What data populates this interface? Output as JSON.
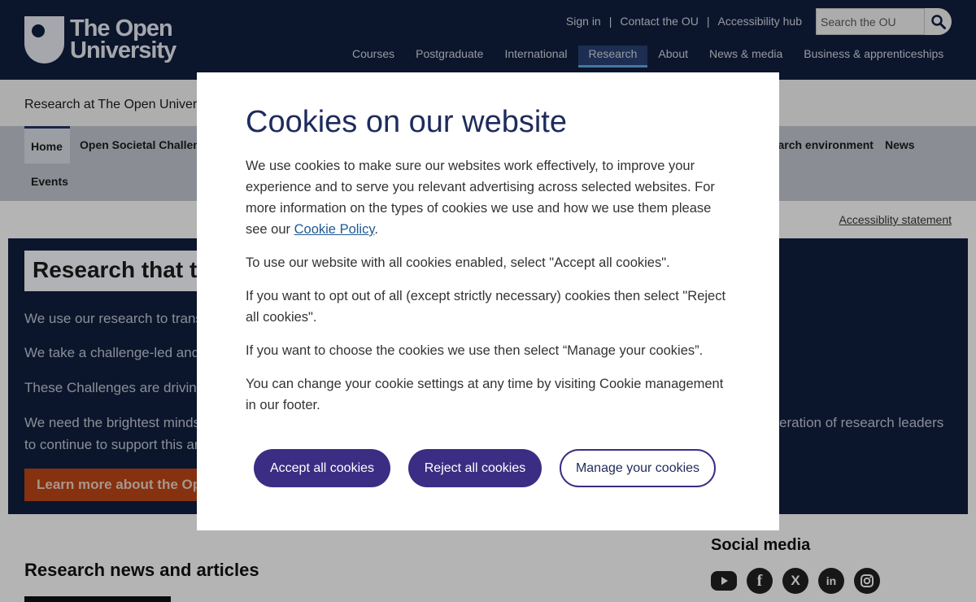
{
  "header": {
    "logo": {
      "line1": "The Open",
      "line2": "University"
    },
    "util_links": [
      "Sign in",
      "Contact the OU",
      "Accessibility hub"
    ],
    "search_placeholder": "Search the OU",
    "nav": [
      "Courses",
      "Postgraduate",
      "International",
      "Research",
      "About",
      "News & media",
      "Business & apprenticeships"
    ],
    "active_nav": "Research"
  },
  "subheader": {
    "title": "Research at The Open University",
    "nav": {
      "home": "Home",
      "open_societal": "Open Societal Challenges",
      "research_env": "Research environment",
      "news": "News",
      "events": "Events"
    }
  },
  "accessibility_statement": "Accessiblity statement",
  "hero": {
    "title": "Research that transforms lives",
    "paragraphs": [
      "We use our research to transform",
      "We take a challenge-led and",
      "These Challenges are driving",
      "We need the brightest minds",
      "to continue to support this and",
      "eration of research leaders"
    ],
    "button": "Learn more about the Open Societal Challenges"
  },
  "lower": {
    "news_heading": "Research news and articles",
    "social_heading": "Social media",
    "social_icons": [
      "youtube-icon",
      "facebook-icon",
      "x-icon",
      "linkedin-icon",
      "instagram-icon"
    ]
  },
  "modal": {
    "title": "Cookies on our website",
    "p1_before": "We use cookies to make sure our websites work effectively, to improve your experience and to serve you relevant advertising across selected websites. For more information on the types of cookies we use and how we use them please see our ",
    "p1_link": "Cookie Policy",
    "p1_after": ".",
    "p2": "To use our website with all cookies enabled, select \"Accept all cookies\".",
    "p3": "If you want to opt out of all (except strictly necessary) cookies then select \"Reject all cookies\".",
    "p4": "If you want to choose the cookies we use then select “Manage your cookies”.",
    "p5": "You can change your cookie settings at any time by visiting Cookie management in our footer.",
    "accept": "Accept all cookies",
    "reject": "Reject all cookies",
    "manage": "Manage your cookies"
  },
  "colors": {
    "header_bg": "#0f1e3c",
    "modal_title": "#1e2b5c",
    "button_primary": "#3b2d83",
    "hero_button": "#b34214"
  }
}
